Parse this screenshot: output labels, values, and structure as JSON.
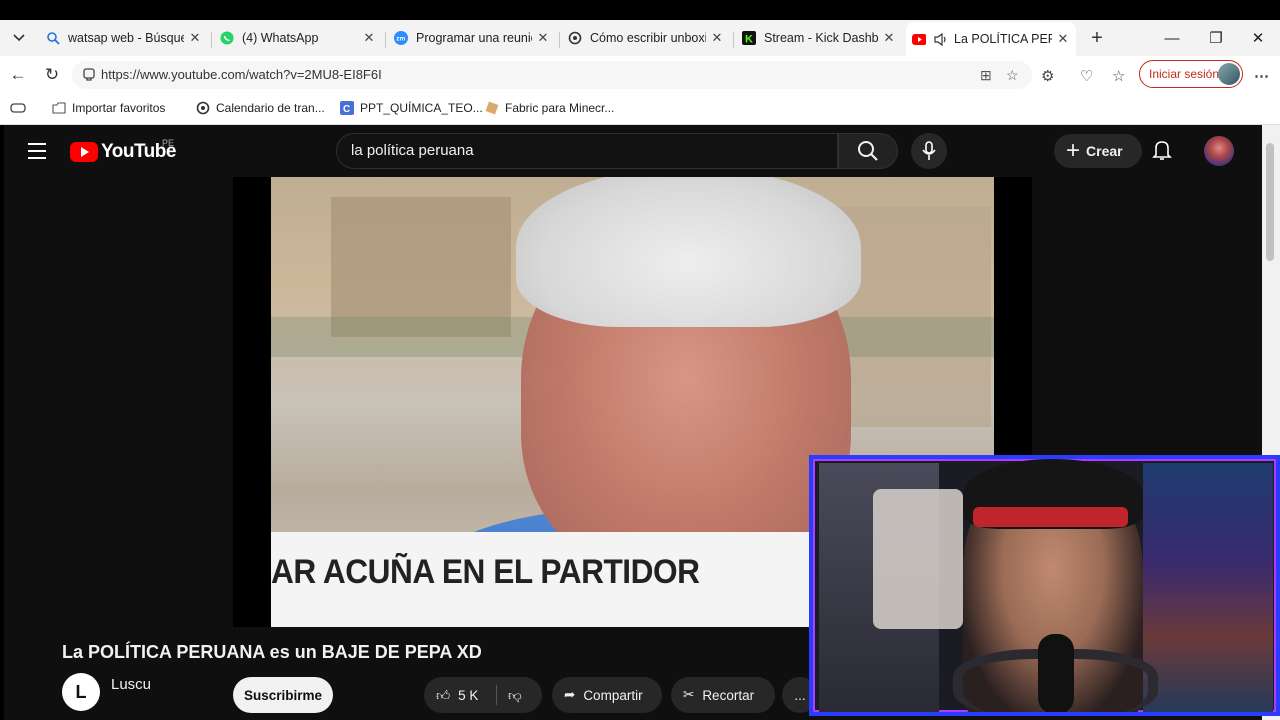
{
  "browser": {
    "tabs": [
      {
        "title": "watsap web - Búsqueda",
        "icon": "search-icon"
      },
      {
        "title": "(4) WhatsApp",
        "icon": "whatsapp-icon"
      },
      {
        "title": "Programar una reunión",
        "icon": "zoom-icon"
      },
      {
        "title": "Cómo escribir unboxing",
        "icon": "openai-icon"
      },
      {
        "title": "Stream - Kick Dashboard",
        "icon": "kick-icon"
      },
      {
        "title": "La POLÍTICA PERUANA",
        "icon": "youtube-icon",
        "active": true
      }
    ],
    "url": "https://www.youtube.com/watch?v=2MU8-EI8F6I",
    "signin_label": "Iniciar sesión",
    "bookmarks": [
      {
        "label": "Importar favoritos",
        "icon": "import-icon"
      },
      {
        "label": "Calendario de tran...",
        "icon": "openai-icon"
      },
      {
        "label": "PPT_QUÍMICA_TEO...",
        "icon": "document-icon"
      },
      {
        "label": "Fabric para Minecr...",
        "icon": "fabric-icon"
      }
    ]
  },
  "youtube": {
    "logo_text": "YouTube",
    "country_code": "PE",
    "search_value": "la política peruana",
    "create_label": "Crear",
    "video": {
      "caption": "AR ACUÑA EN EL PARTIDOR",
      "title": "La POLÍTICA PERUANA es un BAJE DE PEPA XD"
    },
    "channel": {
      "initial": "L",
      "name": "Luscu",
      "subscribe_label": "Suscribirme"
    },
    "actions": {
      "likes": "5 K",
      "share_label": "Compartir",
      "clip_label": "Recortar",
      "more_label": "..."
    }
  },
  "colors": {
    "yt_bg": "#0f0f0f",
    "yt_red": "#ff0000",
    "signin_red": "#c42b1c",
    "webcam_border": "#2a3dff"
  }
}
